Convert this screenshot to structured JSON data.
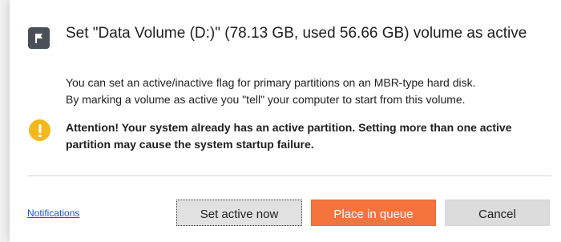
{
  "dialog": {
    "title": "Set \"Data Volume (D:)\" (78.13 GB, used 56.66 GB) volume as active",
    "description_line1": "You can set an active/inactive flag for primary partitions on an MBR-type hard disk.",
    "description_line2": "By marking a volume as active you \"tell\" your computer to start from this volume.",
    "warning": "Attention! Your system already has an active partition. Setting more than one active partition may cause the system startup failure.",
    "notifications_link": "Notifications",
    "buttons": {
      "set_active": "Set active now",
      "place_in_queue": "Place in queue",
      "cancel": "Cancel"
    }
  },
  "icons": {
    "title_icon": "flag-icon",
    "warning_icon": "exclamation-icon"
  },
  "colors": {
    "accent": "#f5743d",
    "warning": "#f3b81b",
    "link": "#1a55d6",
    "icon_badge": "#4a5058"
  }
}
